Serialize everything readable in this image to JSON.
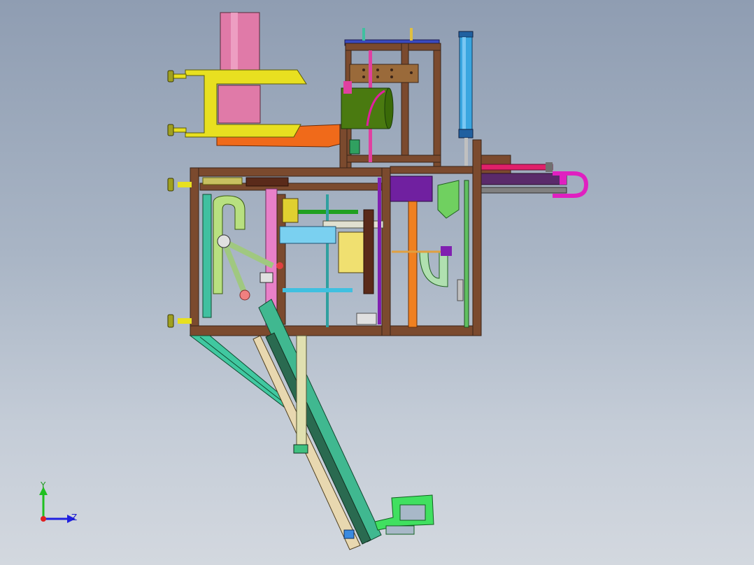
{
  "viewport": {
    "background_top": "#8f9db2",
    "background_bottom": "#d3d8df"
  },
  "colors": {
    "frame": "#7b4a2e",
    "frame_dark": "#3a2418",
    "yellow_bracket": "#e8e020",
    "pink_cylinder": "#e07aa8",
    "orange_plate": "#f06a1a",
    "olive_green_drum": "#4a7a10",
    "blue_cylinder": "#3aa6e0",
    "magenta_hose": "#e020c0",
    "teal_chute": "#40c8a0",
    "lime_bracket": "#40e060",
    "purple_rod": "#8020b0"
  },
  "triad": {
    "y_label": "Y",
    "z_label": "Z",
    "y_color": "#20c020",
    "z_color": "#2020e0",
    "origin_color": "#e02020"
  }
}
